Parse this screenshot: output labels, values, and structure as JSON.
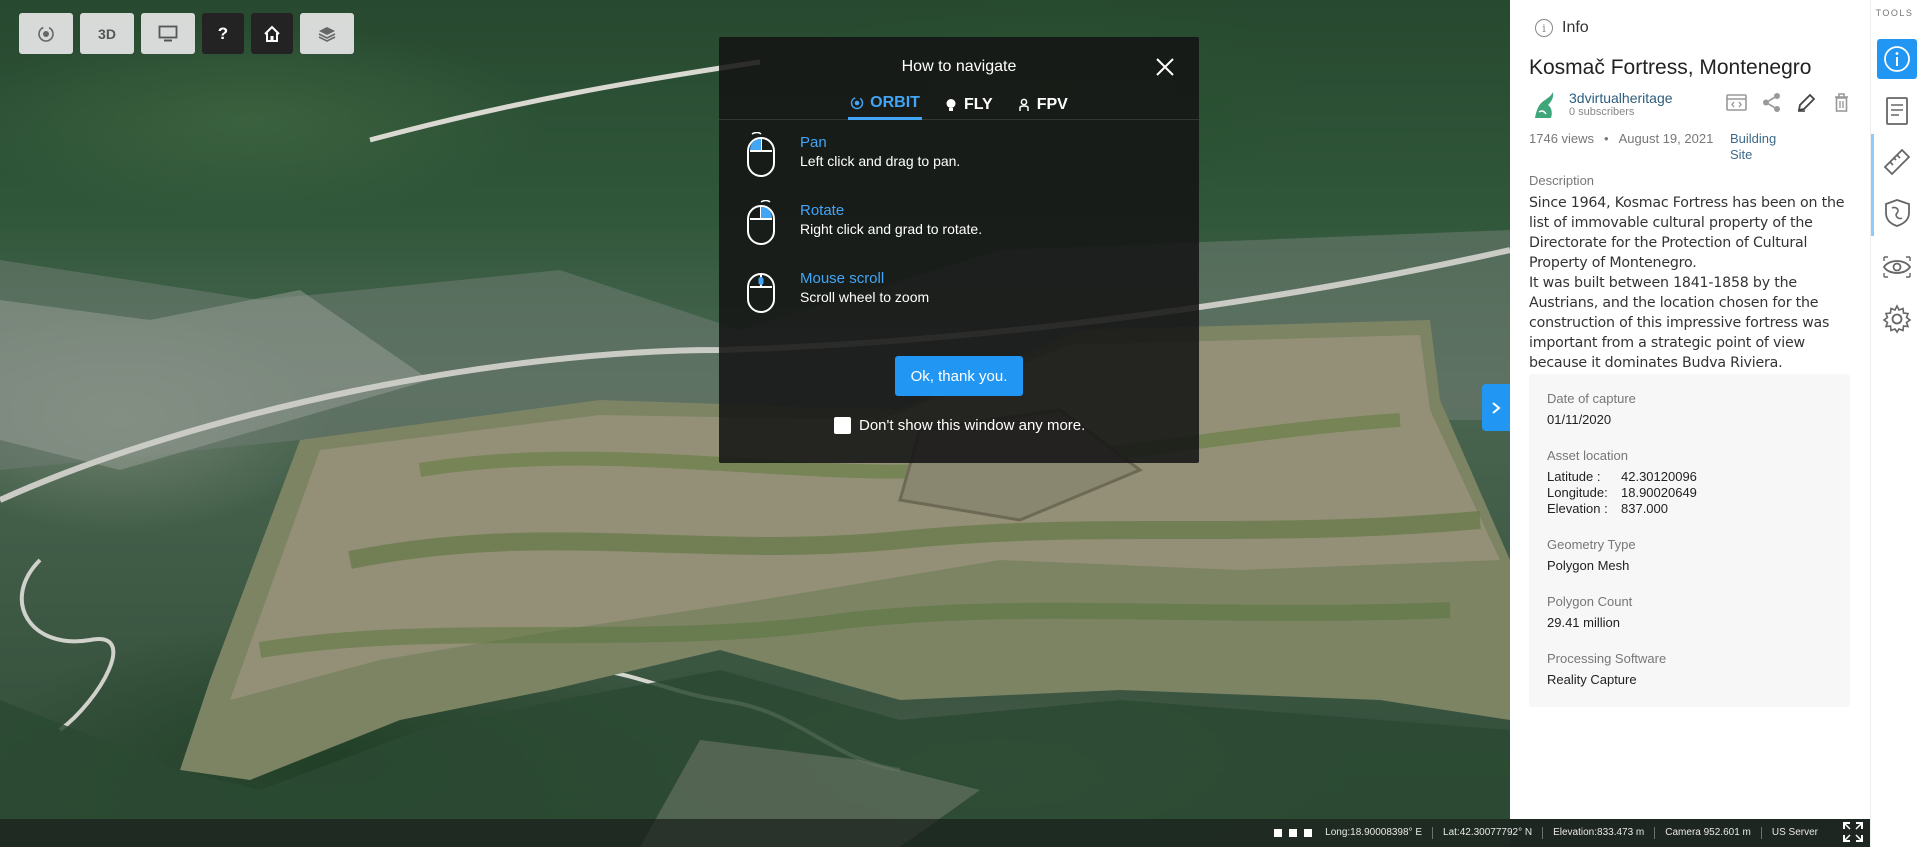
{
  "toolbar": {
    "buttons": [
      {
        "name": "orbit-mode",
        "label": ""
      },
      {
        "name": "view-3d",
        "label": "3D"
      },
      {
        "name": "presentation",
        "label": ""
      },
      {
        "name": "help",
        "label": "?"
      },
      {
        "name": "home",
        "label": ""
      },
      {
        "name": "layers",
        "label": ""
      }
    ]
  },
  "modal": {
    "title": "How to navigate",
    "tabs": [
      {
        "label": "ORBIT",
        "active": true
      },
      {
        "label": "FLY",
        "active": false
      },
      {
        "label": "FPV",
        "active": false
      }
    ],
    "rows": [
      {
        "title": "Pan",
        "text": "Left click and drag to pan."
      },
      {
        "title": "Rotate",
        "text": "Right click and grad to rotate."
      },
      {
        "title": "Mouse scroll",
        "text": "Scroll wheel to zoom"
      }
    ],
    "ok_label": "Ok, thank you.",
    "dont_show_label": "Don't show this window any more.",
    "dont_show_checked": false
  },
  "statusbar": {
    "long": "Long:18.90008398° E",
    "lat": "Lat:42.30077792° N",
    "elevation": "Elevation:833.473 m",
    "camera": "Camera 952.601 m",
    "server": "US Server"
  },
  "panel": {
    "header": "Info",
    "title": "Kosmač Fortress, Montenegro",
    "author": {
      "name": "3dvirtualheritage",
      "subscribers": "0 subscribers"
    },
    "views": "1746 views",
    "date": "August 19, 2021",
    "category": "Building Site",
    "description_label": "Description",
    "description": [
      "Since 1964, Kosmac Fortress has been on the list of immovable cultural property of the Directorate for the Protection of Cultural Property of Montenegro.",
      "It was built between 1841-1858 by the Austrians, and the location chosen for the construction of this impressive fortress was important from a strategic point of view because it dominates Budva Riviera."
    ],
    "properties": {
      "date_label": "Date of capture",
      "date_value": "01/11/2020",
      "location_label": "Asset location",
      "latitude_key": "Latitude :",
      "latitude": "42.30120096",
      "longitude_key": "Longitude:",
      "longitude": "18.90020649",
      "elevation_key": "Elevation :",
      "elevation": "837.000",
      "geometry_label": "Geometry Type",
      "geometry_value": "Polygon Mesh",
      "polycount_label": "Polygon Count",
      "polycount_value": "29.41 million",
      "software_label": "Processing Software",
      "software_value": "Reality Capture"
    }
  },
  "rail": {
    "title": "TOOLS",
    "tools": [
      "info",
      "notes",
      "measure",
      "annotations",
      "visibility",
      "settings"
    ]
  },
  "colors": {
    "accent": "#2196f3",
    "link": "#42a5f5",
    "panel_bg": "#ffffff"
  }
}
